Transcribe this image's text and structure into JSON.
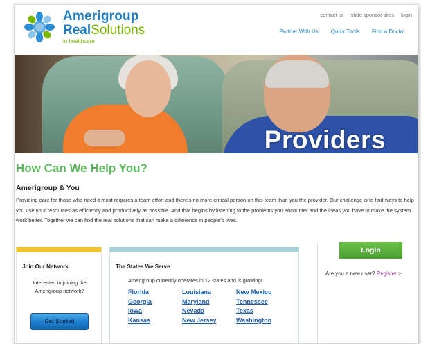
{
  "brand": {
    "name_line1": "Amerigroup",
    "name_line2_a": "Real",
    "name_line2_b": "Solutions",
    "tagline": "in healthcare"
  },
  "utility_nav": [
    "contact us",
    "state sponsor sites",
    "login"
  ],
  "main_nav": [
    "Partner With Us",
    "Quick Tools",
    "Find a Doctor"
  ],
  "hero": {
    "title": "Providers"
  },
  "help_heading": "How Can We Help You?",
  "section_title": "Amerigroup & You",
  "intro_text": "Providing care for those who need it most requires a team effort and there's no more critical person on this team than you the provider. Our challenge is to find ways to help you use your resources as efficiently and productively as possible. And that begins by listening to the problems you encounter and the ideas you have to make the system work better. Together we can find the real solutions that can make a difference in people's lives.",
  "network_box": {
    "title": "Join Our Network",
    "description": "Interested in joining the Amerigroup network?",
    "button": "Get Started"
  },
  "states_box": {
    "title": "The States We Serve",
    "description": "Amerigroup currently operates in 12 states and is growing!",
    "states": [
      "Florida",
      "Louisiana",
      "New Mexico",
      "Georgia",
      "Maryland",
      "Tennessee",
      "Iowa",
      "Nevada",
      "Texas",
      "Kansas",
      "New Jersey",
      "Washington"
    ]
  },
  "login": {
    "button": "Login",
    "new_user_text": "Are you a new user?",
    "register_link": "Register >"
  },
  "colors": {
    "brand_blue": "#1f7bbf",
    "brand_green": "#7ab800",
    "heading_green": "#5cb85c",
    "link_purple": "#8a2d8a"
  }
}
